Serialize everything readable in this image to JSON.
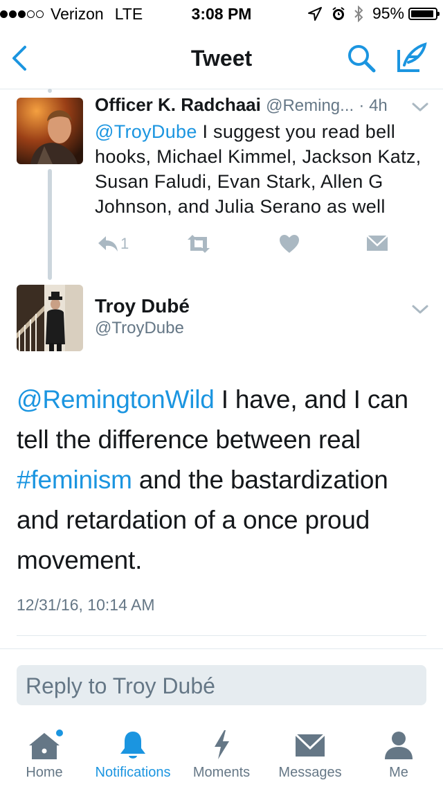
{
  "status_bar": {
    "carrier": "Verizon",
    "network": "LTE",
    "time": "3:08 PM",
    "battery": "95%",
    "battery_level": 0.95,
    "signal_bars": 3
  },
  "nav": {
    "title": "Tweet",
    "icons": [
      "back-chevron-icon",
      "search-icon",
      "compose-icon"
    ]
  },
  "parent_tweet": {
    "name": "Officer K. Radchaai",
    "handle": "@Reming...",
    "time": "· 4h",
    "mention": "@TroyDube",
    "text": " I suggest you read bell hooks, Michael Kimmel, Jackson Katz, Susan Faludi, Evan Stark, Allen G Johnson, and Julia Serano as well",
    "reply_count": "1",
    "icons": [
      "reply-icon",
      "retweet-icon",
      "like-icon",
      "direct-message-icon"
    ]
  },
  "main_tweet": {
    "name": "Troy Dubé",
    "handle": "@TroyDube",
    "mention": "@RemingtonWild",
    "text_1": " I have, and I can tell the difference between real ",
    "hashtag": "#feminism",
    "text_2": " and the bastardization and retardation of a once proud movement.",
    "timestamp": "12/31/16, 10:14 AM"
  },
  "reply": {
    "placeholder": "Reply to Troy Dubé"
  },
  "tabs": [
    {
      "label": "Home",
      "icon": "home-icon",
      "active": false,
      "notification_dot": true
    },
    {
      "label": "Notifications",
      "icon": "bell-icon",
      "active": true
    },
    {
      "label": "Moments",
      "icon": "lightning-icon",
      "active": false
    },
    {
      "label": "Messages",
      "icon": "envelope-icon",
      "active": false
    },
    {
      "label": "Me",
      "icon": "person-icon",
      "active": false
    }
  ],
  "colors": {
    "accent": "#1b95e0",
    "secondary_text": "#657786",
    "icon_grey": "#aab8c2",
    "thread_line": "#ccd6dd"
  }
}
